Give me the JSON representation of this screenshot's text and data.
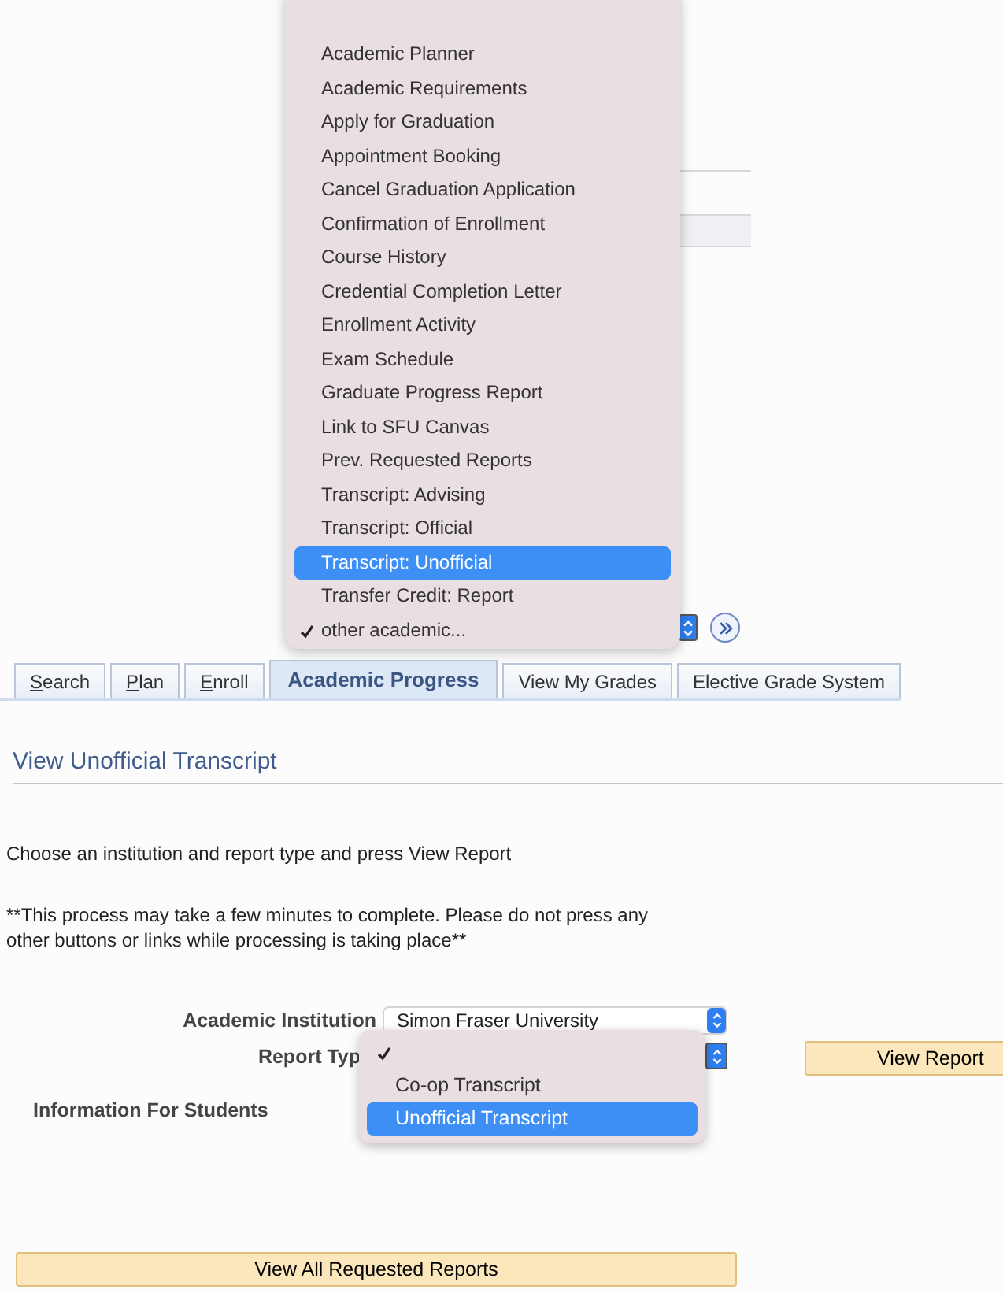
{
  "menu": {
    "items": [
      {
        "label": "Academic Planner",
        "selected": false,
        "checked": false
      },
      {
        "label": "Academic Requirements",
        "selected": false,
        "checked": false
      },
      {
        "label": "Apply for Graduation",
        "selected": false,
        "checked": false
      },
      {
        "label": "Appointment Booking",
        "selected": false,
        "checked": false
      },
      {
        "label": "Cancel Graduation Application",
        "selected": false,
        "checked": false
      },
      {
        "label": "Confirmation of Enrollment",
        "selected": false,
        "checked": false
      },
      {
        "label": "Course History",
        "selected": false,
        "checked": false
      },
      {
        "label": "Credential Completion Letter",
        "selected": false,
        "checked": false
      },
      {
        "label": "Enrollment Activity",
        "selected": false,
        "checked": false
      },
      {
        "label": "Exam Schedule",
        "selected": false,
        "checked": false
      },
      {
        "label": "Graduate Progress Report",
        "selected": false,
        "checked": false
      },
      {
        "label": "Link to SFU Canvas",
        "selected": false,
        "checked": false
      },
      {
        "label": "Prev. Requested Reports",
        "selected": false,
        "checked": false
      },
      {
        "label": "Transcript: Advising",
        "selected": false,
        "checked": false
      },
      {
        "label": "Transcript: Official",
        "selected": false,
        "checked": false
      },
      {
        "label": "Transcript: Unofficial",
        "selected": true,
        "checked": false
      },
      {
        "label": "Transfer Credit: Report",
        "selected": false,
        "checked": false
      },
      {
        "label": "other academic...",
        "selected": false,
        "checked": true
      }
    ]
  },
  "tabs": [
    {
      "label": "Search",
      "selected": false,
      "underlined_first_letter": true
    },
    {
      "label": "Plan",
      "selected": false,
      "underlined_first_letter": true
    },
    {
      "label": "Enroll",
      "selected": false,
      "underlined_first_letter": true
    },
    {
      "label": "Academic Progress",
      "selected": true,
      "underlined_first_letter": false
    },
    {
      "label": "View My Grades",
      "selected": false,
      "underlined_first_letter": false
    },
    {
      "label": "Elective Grade System",
      "selected": false,
      "underlined_first_letter": false
    }
  ],
  "page_title": "View Unofficial Transcript",
  "instructions": "Choose an institution and report type and press View Report",
  "warning": "**This process may take a few minutes to complete. Please do not press any other buttons or links while processing is taking place**",
  "form": {
    "institution_label": "Academic Institution",
    "institution_value": "Simon Fraser University",
    "report_type_label": "Report Typ",
    "report_type_options": [
      {
        "checked": true,
        "selected": false
      },
      {
        "label": "Co-op Transcript",
        "checked": false,
        "selected": false
      },
      {
        "label": "Unofficial Transcript",
        "checked": false,
        "selected": true
      }
    ],
    "view_report_button": "View Report",
    "info_label": "Information For Students"
  },
  "view_all_button": "View All Requested Reports"
}
